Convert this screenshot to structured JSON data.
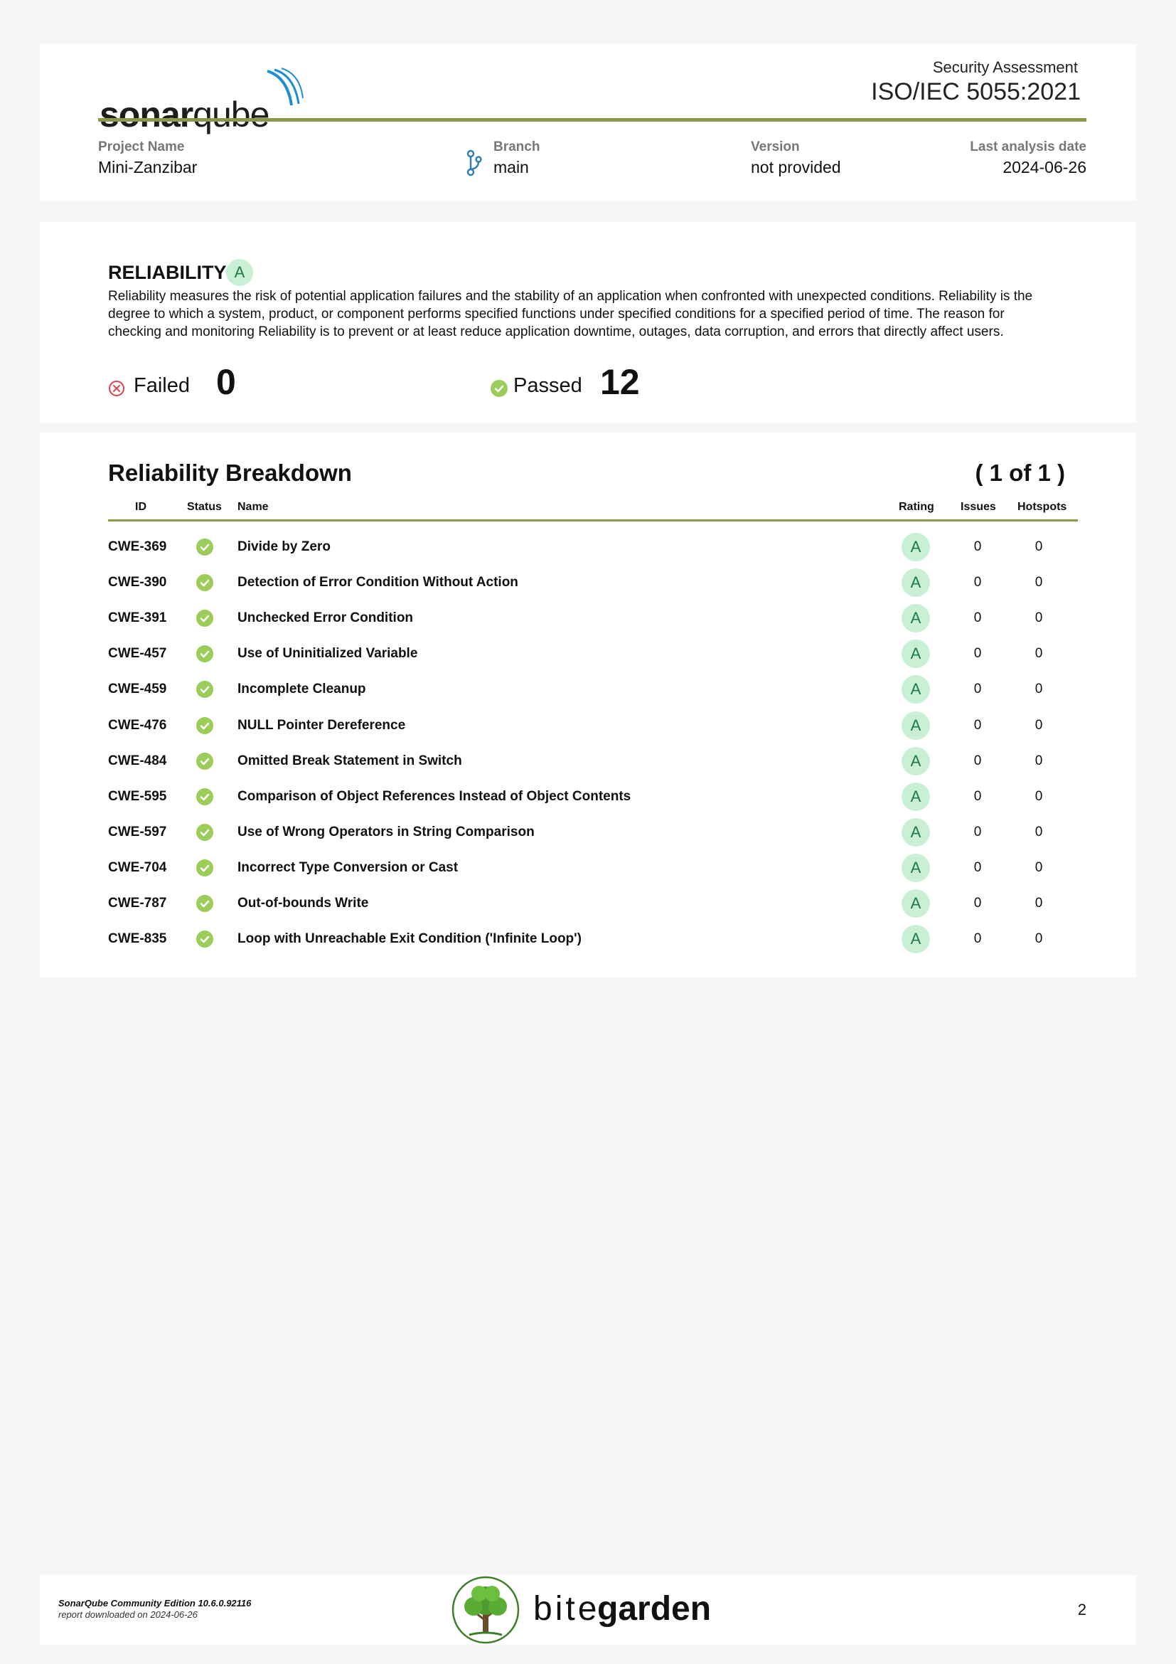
{
  "header": {
    "logo_text_bold": "sonar",
    "logo_text_light": "qube",
    "assessment_label": "Security Assessment",
    "standard_label": "ISO/IEC 5055:2021",
    "project_name_label": "Project Name",
    "project_name": "Mini-Zanzibar",
    "branch_label": "Branch",
    "branch": "main",
    "branch_icon": "git-branch-icon",
    "version_label": "Version",
    "version": "not provided",
    "last_analysis_label": "Last analysis date",
    "last_analysis_date": "2024-06-26",
    "accent_color": "#8a9a4a"
  },
  "reliability": {
    "title": "RELIABILITY",
    "rating": "A",
    "description": "Reliability measures the risk of potential application failures and the stability of an application when confronted with unexpected conditions. Reliability is the degree to which a system, product, or component performs specified functions under specified conditions for a specified period of time. The reason for checking and monitoring Reliability is to prevent or at least reduce application downtime, outages, data corruption, and errors that directly affect users.",
    "failed_label": "Failed",
    "failed_count": "0",
    "failed_icon": "x-circle-icon",
    "passed_label": "Passed",
    "passed_count": "12",
    "passed_icon": "check-circle-icon",
    "rating_badge_color": "#c9f0d4",
    "passed_color": "#9ccc5a",
    "failed_color": "#e0424b"
  },
  "breakdown": {
    "title": "Reliability Breakdown",
    "page_indicator": "( 1 of 1 )",
    "columns": {
      "id": "ID",
      "status": "Status",
      "name": "Name",
      "rating": "Rating",
      "issues": "Issues",
      "hotspots": "Hotspots"
    },
    "rows": [
      {
        "id": "CWE-369",
        "status": "passed",
        "name": "Divide by Zero",
        "rating": "A",
        "issues": "0",
        "hotspots": "0"
      },
      {
        "id": "CWE-390",
        "status": "passed",
        "name": "Detection of Error Condition Without Action",
        "rating": "A",
        "issues": "0",
        "hotspots": "0"
      },
      {
        "id": "CWE-391",
        "status": "passed",
        "name": "Unchecked Error Condition",
        "rating": "A",
        "issues": "0",
        "hotspots": "0"
      },
      {
        "id": "CWE-457",
        "status": "passed",
        "name": "Use of Uninitialized Variable",
        "rating": "A",
        "issues": "0",
        "hotspots": "0"
      },
      {
        "id": "CWE-459",
        "status": "passed",
        "name": "Incomplete Cleanup",
        "rating": "A",
        "issues": "0",
        "hotspots": "0"
      },
      {
        "id": "CWE-476",
        "status": "passed",
        "name": "NULL Pointer Dereference",
        "rating": "A",
        "issues": "0",
        "hotspots": "0"
      },
      {
        "id": "CWE-484",
        "status": "passed",
        "name": "Omitted Break Statement in Switch",
        "rating": "A",
        "issues": "0",
        "hotspots": "0"
      },
      {
        "id": "CWE-595",
        "status": "passed",
        "name": "Comparison of Object References Instead of Object Contents",
        "rating": "A",
        "issues": "0",
        "hotspots": "0"
      },
      {
        "id": "CWE-597",
        "status": "passed",
        "name": "Use of Wrong Operators in String Comparison",
        "rating": "A",
        "issues": "0",
        "hotspots": "0"
      },
      {
        "id": "CWE-704",
        "status": "passed",
        "name": "Incorrect Type Conversion or Cast",
        "rating": "A",
        "issues": "0",
        "hotspots": "0"
      },
      {
        "id": "CWE-787",
        "status": "passed",
        "name": "Out-of-bounds Write",
        "rating": "A",
        "issues": "0",
        "hotspots": "0"
      },
      {
        "id": "CWE-835",
        "status": "passed",
        "name": "Loop with Unreachable Exit Condition ('Infinite Loop')",
        "rating": "A",
        "issues": "0",
        "hotspots": "0"
      }
    ]
  },
  "footer": {
    "edition": "SonarQube Community Edition 10.6.0.92116",
    "downloaded": "report downloaded on 2024-06-26",
    "brand_light": "bite",
    "brand_bold": "garden",
    "brand_icon": "tree-logo-icon",
    "page_number": "2"
  }
}
